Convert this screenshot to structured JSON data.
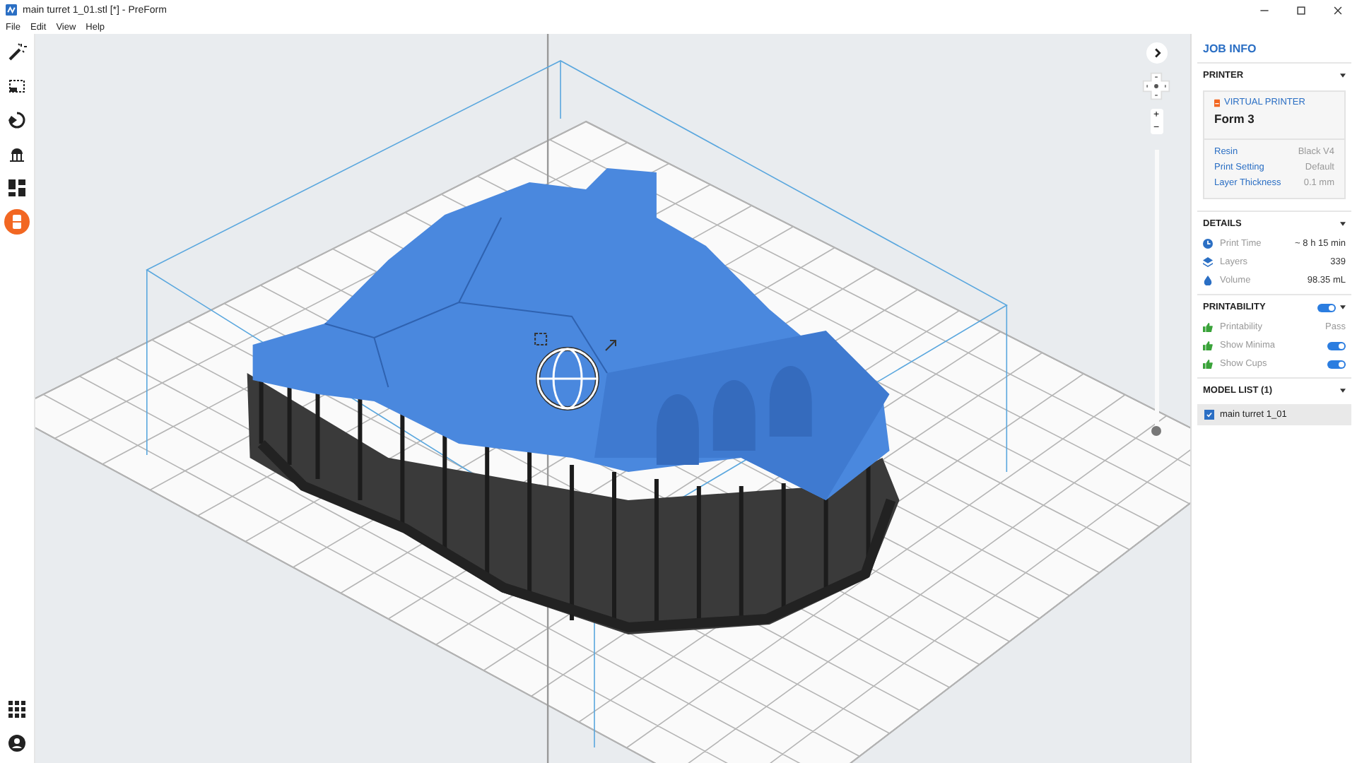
{
  "window": {
    "title": "main turret 1_01.stl [*] - PreForm"
  },
  "menu": [
    "File",
    "Edit",
    "View",
    "Help"
  ],
  "tools": [
    {
      "kind": "wand",
      "selected": false
    },
    {
      "kind": "select",
      "selected": false
    },
    {
      "kind": "orient",
      "selected": false
    },
    {
      "kind": "supports",
      "selected": false
    },
    {
      "kind": "layout",
      "selected": false
    },
    {
      "kind": "print",
      "selected": true
    }
  ],
  "bottom_tools": [
    {
      "kind": "apps"
    },
    {
      "kind": "account"
    }
  ],
  "viewport": {
    "zoom_in": "+",
    "zoom_out": "−",
    "layer_slider": {
      "level": 0
    }
  },
  "job_info": {
    "title": "JOB INFO",
    "printer": {
      "title": "PRINTER",
      "status": "VIRTUAL PRINTER",
      "name": "Form 3",
      "rows": [
        {
          "label": "Resin",
          "value": "Black V4"
        },
        {
          "label": "Print Setting",
          "value": "Default"
        },
        {
          "label": "Layer Thickness",
          "value": "0.1 mm"
        }
      ]
    },
    "details": {
      "title": "DETAILS",
      "rows": [
        {
          "kind": "time",
          "label": "Print Time",
          "value": "~ 8 h 15 min"
        },
        {
          "kind": "layers",
          "label": "Layers",
          "value": "339"
        },
        {
          "kind": "volume",
          "label": "Volume",
          "value": "98.35 mL"
        }
      ]
    },
    "printability": {
      "title": "PRINTABILITY",
      "on": true,
      "rows": [
        {
          "kind": "text",
          "label": "Printability",
          "value": "Pass"
        },
        {
          "kind": "toggle",
          "label": "Show Minima",
          "on": true
        },
        {
          "kind": "toggle",
          "label": "Show Cups",
          "on": true
        }
      ]
    },
    "model_list": {
      "title": "MODEL LIST (1)",
      "items": [
        {
          "name": "main turret 1_01",
          "checked": true,
          "selected": true
        }
      ]
    }
  }
}
